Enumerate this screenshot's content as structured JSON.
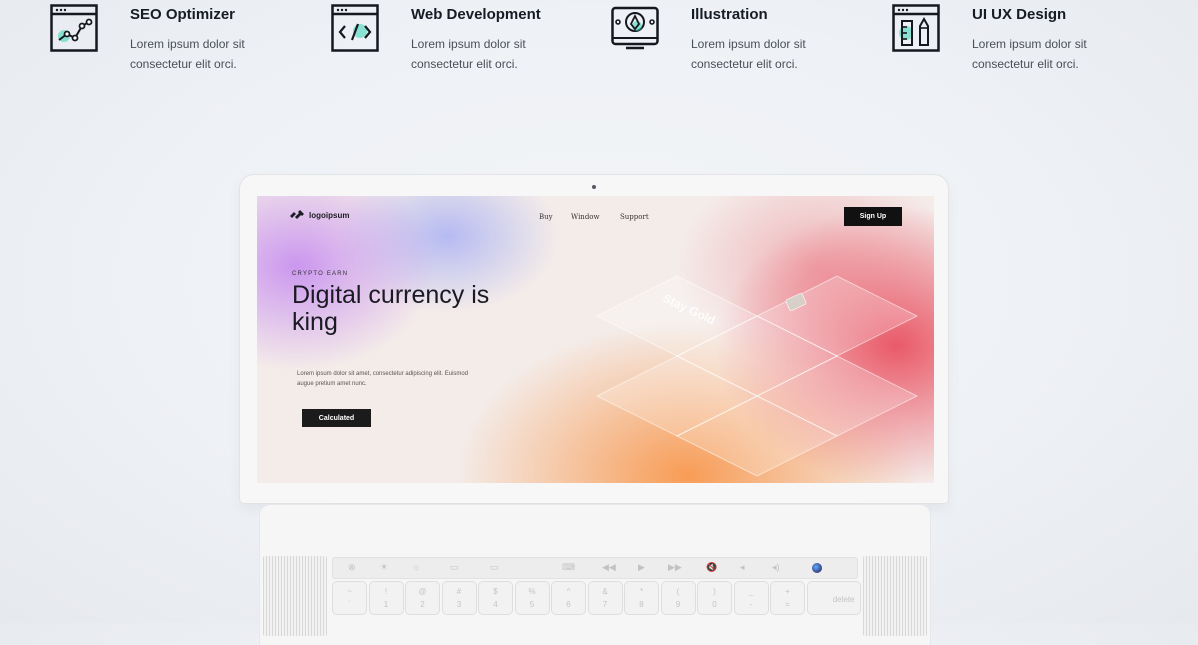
{
  "services": [
    {
      "icon": "seo-chart-icon",
      "title": "SEO Optimizer",
      "desc": "Lorem ipsum dolor sit consectetur elit orci."
    },
    {
      "icon": "code-window-icon",
      "title": "Web Development",
      "desc": "Lorem ipsum dolor sit consectetur elit orci."
    },
    {
      "icon": "pen-tool-monitor-icon",
      "title": "Illustration",
      "desc": "Lorem ipsum dolor sit consectetur elit orci."
    },
    {
      "icon": "design-tools-icon",
      "title": "UI UX Design",
      "desc": "Lorem ipsum dolor sit consectetur elit orci."
    }
  ],
  "laptop_screen": {
    "logo": "logoipsum",
    "nav": [
      "Buy",
      "Window",
      "Support"
    ],
    "signup": "Sign Up",
    "eyebrow": "CRYPTO EARN",
    "headline": "Digital currency is king",
    "body": "Lorem ipsum dolor sit amet, consectetur adipiscing elit. Euismod augue pretium amet nunc.",
    "cta": "Calculated",
    "card_text": "Stay Gold"
  },
  "keyboard": {
    "touchbar": [
      "⊗",
      "☀",
      "☼",
      "▭",
      "▭",
      "⌨",
      "◀◀",
      "▶",
      "▶▶",
      "🔇",
      "◂",
      "◂)"
    ],
    "number_keys": [
      [
        "~",
        "`"
      ],
      [
        "!",
        "1"
      ],
      [
        "@",
        "2"
      ],
      [
        "#",
        "3"
      ],
      [
        "$",
        "4"
      ],
      [
        "%",
        "5"
      ],
      [
        "^",
        "6"
      ],
      [
        "&",
        "7"
      ],
      [
        "*",
        "8"
      ],
      [
        "(",
        "9"
      ],
      [
        ")",
        "0"
      ],
      [
        "_",
        "-"
      ],
      [
        "+",
        "="
      ]
    ],
    "delete": "delete"
  },
  "colors": {
    "accent": "#35d6b7",
    "dark": "#111111"
  }
}
